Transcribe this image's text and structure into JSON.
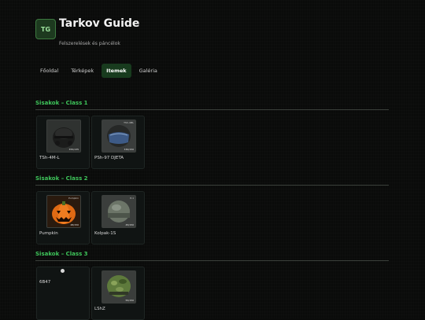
{
  "app": {
    "logo": "TG",
    "title": "Tarkov Guide",
    "subtitle": "Felszerelések és páncélok"
  },
  "nav": {
    "tabs": [
      "Főoldal",
      "Térképek",
      "Itemek",
      "Galéria"
    ],
    "active": "Itemek"
  },
  "sections": [
    {
      "title": "Sisakok – Class 1",
      "items": [
        {
          "name": "TSh-4M-L",
          "tag": "355/135"
        },
        {
          "name": "PSh-97 DJETA",
          "tag": "330/150",
          "top_tag": "TSh-4ML"
        }
      ]
    },
    {
      "title": "Sisakok – Class 2",
      "items": [
        {
          "name": "Pumpkin",
          "tag": "48/150",
          "top_tag": "Pumpkin"
        },
        {
          "name": "Kolpak-1S",
          "tag": "45/150",
          "top_tag": "P-1"
        }
      ]
    },
    {
      "title": "Sisakok – Class 3",
      "items": [
        {
          "name": "6B47"
        },
        {
          "name": "LShZ",
          "tag": "55/150"
        }
      ]
    }
  ],
  "colors": {
    "accent": "#3ec45a",
    "background": "#0a0b0a",
    "active_tab": "#183b1e"
  },
  "icons": [
    "tank-helmet-icon",
    "visor-helmet-icon",
    "pumpkin-icon",
    "kolpak-helmet-icon",
    "camo-helmet-icon"
  ]
}
